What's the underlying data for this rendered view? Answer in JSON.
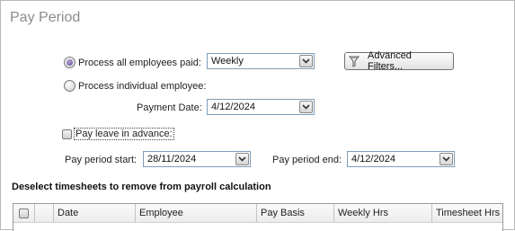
{
  "section_title": "Pay Period",
  "process_all": {
    "label": "Process all employees paid:",
    "selected": true,
    "frequency": "Weekly"
  },
  "advanced_filters": {
    "label": "Advanced Filters..."
  },
  "process_individual": {
    "label": "Process individual employee:",
    "selected": false
  },
  "payment_date": {
    "label": "Payment Date:",
    "value": "4/12/2024"
  },
  "pay_leave": {
    "label": "Pay leave in advance:",
    "checked": false
  },
  "period_start": {
    "label": "Pay period start:",
    "value": "28/11/2024"
  },
  "period_end": {
    "label": "Pay period end:",
    "value": "4/12/2024"
  },
  "timesheets": {
    "heading": "Deselect timesheets to remove from payroll calculation",
    "columns": [
      "Date",
      "Employee",
      "Pay Basis",
      "Weekly Hrs",
      "Timesheet Hrs"
    ]
  },
  "colors": {
    "title": "#8c8c8c",
    "field_border": "#7f9db9",
    "radio_selected": "#6e55a4"
  },
  "icons": {
    "dropdown": "chevron-down-icon",
    "filter": "funnel-icon"
  }
}
